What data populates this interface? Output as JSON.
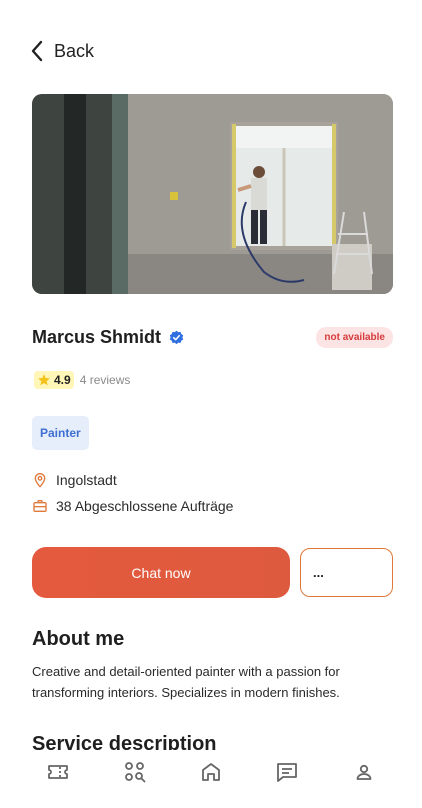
{
  "header": {
    "back_label": "Back"
  },
  "profile": {
    "name": "Marcus Shmidt",
    "availability": "not available",
    "rating": "4.9",
    "reviews": "4 reviews",
    "tag": "Painter",
    "location": "Ingolstadt",
    "jobs": "38 Abgeschlossene Aufträge"
  },
  "actions": {
    "chat_label": "Chat now",
    "more_label": "..."
  },
  "about": {
    "heading": "About me",
    "text": "Creative and detail-oriented painter with a passion for transforming interiors. Specializes in modern finishes."
  },
  "service": {
    "heading": "Service description"
  },
  "nav": {
    "items": [
      {
        "icon": "ticket-icon"
      },
      {
        "icon": "search-grid-icon"
      },
      {
        "icon": "home-icon"
      },
      {
        "icon": "chat-icon"
      },
      {
        "icon": "profile-icon"
      }
    ]
  },
  "colors": {
    "accent": "#e45a3e",
    "accent_border": "#e0783a",
    "verified": "#2f6fe0",
    "tag_bg": "#e6eefc",
    "tag_text": "#3e6fd1",
    "unavailable_bg": "#fde4e4",
    "unavailable_text": "#d63a3a",
    "rating_bg": "#fff6b8"
  }
}
